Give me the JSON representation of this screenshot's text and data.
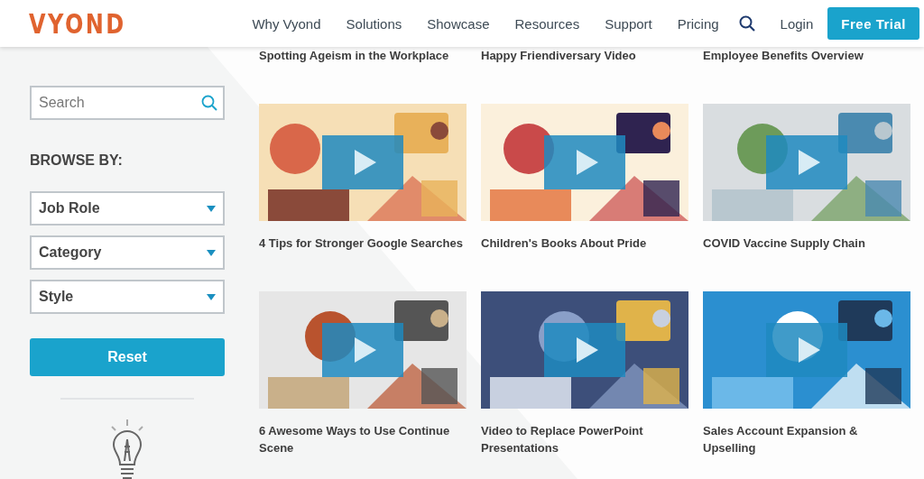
{
  "header": {
    "logo": "VYOND",
    "nav": [
      "Why Vyond",
      "Solutions",
      "Showcase",
      "Resources",
      "Support",
      "Pricing"
    ],
    "login": "Login",
    "cta": "Free Trial"
  },
  "sidebar": {
    "search": {
      "placeholder": "Search"
    },
    "browse_label": "BROWSE BY:",
    "filters": [
      "Job Role",
      "Category",
      "Style"
    ],
    "reset": "Reset"
  },
  "videos_partial": [
    "Spotting Ageism in the Workplace",
    "Happy Friendiversary Video",
    "Employee Benefits Overview"
  ],
  "videos": [
    {
      "title": "4 Tips for Stronger Google Searches",
      "kind": "picture"
    },
    {
      "title": "Children's Books About Pride",
      "kind": "picture"
    },
    {
      "title": "COVID Vaccine Supply Chain",
      "kind": "picture"
    },
    {
      "title": "6 Awesome Ways to Use Continue Scene",
      "kind": "picture"
    },
    {
      "title": "Video to Replace PowerPoint Presentations",
      "kind": "picture"
    },
    {
      "title": "Sales Account Expansion & Upselling",
      "kind": "picture"
    }
  ]
}
